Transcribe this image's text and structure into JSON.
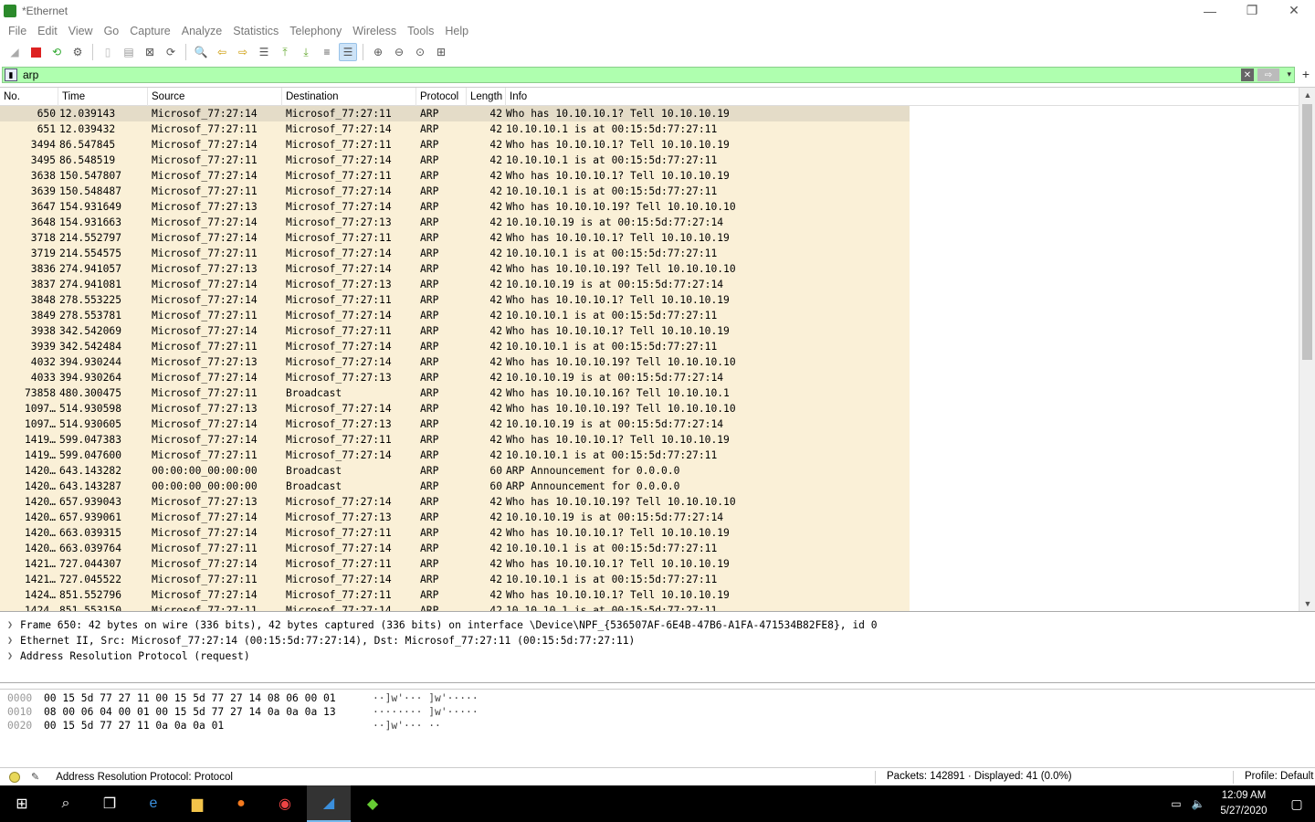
{
  "window": {
    "title": "*Ethernet",
    "controls": [
      "—",
      "❐",
      "✕"
    ]
  },
  "menu": [
    "File",
    "Edit",
    "View",
    "Go",
    "Capture",
    "Analyze",
    "Statistics",
    "Telephony",
    "Wireless",
    "Tools",
    "Help"
  ],
  "filter": {
    "value": "arp"
  },
  "columns": [
    "No.",
    "Time",
    "Source",
    "Destination",
    "Protocol",
    "Length",
    "Info"
  ],
  "packets": [
    [
      "650",
      "12.039143",
      "Microsof_77:27:14",
      "Microsof_77:27:11",
      "ARP",
      "42",
      "Who has 10.10.10.1? Tell 10.10.10.19"
    ],
    [
      "651",
      "12.039432",
      "Microsof_77:27:11",
      "Microsof_77:27:14",
      "ARP",
      "42",
      "10.10.10.1 is at 00:15:5d:77:27:11"
    ],
    [
      "3494",
      "86.547845",
      "Microsof_77:27:14",
      "Microsof_77:27:11",
      "ARP",
      "42",
      "Who has 10.10.10.1? Tell 10.10.10.19"
    ],
    [
      "3495",
      "86.548519",
      "Microsof_77:27:11",
      "Microsof_77:27:14",
      "ARP",
      "42",
      "10.10.10.1 is at 00:15:5d:77:27:11"
    ],
    [
      "3638",
      "150.547807",
      "Microsof_77:27:14",
      "Microsof_77:27:11",
      "ARP",
      "42",
      "Who has 10.10.10.1? Tell 10.10.10.19"
    ],
    [
      "3639",
      "150.548487",
      "Microsof_77:27:11",
      "Microsof_77:27:14",
      "ARP",
      "42",
      "10.10.10.1 is at 00:15:5d:77:27:11"
    ],
    [
      "3647",
      "154.931649",
      "Microsof_77:27:13",
      "Microsof_77:27:14",
      "ARP",
      "42",
      "Who has 10.10.10.19? Tell 10.10.10.10"
    ],
    [
      "3648",
      "154.931663",
      "Microsof_77:27:14",
      "Microsof_77:27:13",
      "ARP",
      "42",
      "10.10.10.19 is at 00:15:5d:77:27:14"
    ],
    [
      "3718",
      "214.552797",
      "Microsof_77:27:14",
      "Microsof_77:27:11",
      "ARP",
      "42",
      "Who has 10.10.10.1? Tell 10.10.10.19"
    ],
    [
      "3719",
      "214.554575",
      "Microsof_77:27:11",
      "Microsof_77:27:14",
      "ARP",
      "42",
      "10.10.10.1 is at 00:15:5d:77:27:11"
    ],
    [
      "3836",
      "274.941057",
      "Microsof_77:27:13",
      "Microsof_77:27:14",
      "ARP",
      "42",
      "Who has 10.10.10.19? Tell 10.10.10.10"
    ],
    [
      "3837",
      "274.941081",
      "Microsof_77:27:14",
      "Microsof_77:27:13",
      "ARP",
      "42",
      "10.10.10.19 is at 00:15:5d:77:27:14"
    ],
    [
      "3848",
      "278.553225",
      "Microsof_77:27:14",
      "Microsof_77:27:11",
      "ARP",
      "42",
      "Who has 10.10.10.1? Tell 10.10.10.19"
    ],
    [
      "3849",
      "278.553781",
      "Microsof_77:27:11",
      "Microsof_77:27:14",
      "ARP",
      "42",
      "10.10.10.1 is at 00:15:5d:77:27:11"
    ],
    [
      "3938",
      "342.542069",
      "Microsof_77:27:14",
      "Microsof_77:27:11",
      "ARP",
      "42",
      "Who has 10.10.10.1? Tell 10.10.10.19"
    ],
    [
      "3939",
      "342.542484",
      "Microsof_77:27:11",
      "Microsof_77:27:14",
      "ARP",
      "42",
      "10.10.10.1 is at 00:15:5d:77:27:11"
    ],
    [
      "4032",
      "394.930244",
      "Microsof_77:27:13",
      "Microsof_77:27:14",
      "ARP",
      "42",
      "Who has 10.10.10.19? Tell 10.10.10.10"
    ],
    [
      "4033",
      "394.930264",
      "Microsof_77:27:14",
      "Microsof_77:27:13",
      "ARP",
      "42",
      "10.10.10.19 is at 00:15:5d:77:27:14"
    ],
    [
      "73858",
      "480.300475",
      "Microsof_77:27:11",
      "Broadcast",
      "ARP",
      "42",
      "Who has 10.10.10.16? Tell 10.10.10.1"
    ],
    [
      "1097…",
      "514.930598",
      "Microsof_77:27:13",
      "Microsof_77:27:14",
      "ARP",
      "42",
      "Who has 10.10.10.19? Tell 10.10.10.10"
    ],
    [
      "1097…",
      "514.930605",
      "Microsof_77:27:14",
      "Microsof_77:27:13",
      "ARP",
      "42",
      "10.10.10.19 is at 00:15:5d:77:27:14"
    ],
    [
      "1419…",
      "599.047383",
      "Microsof_77:27:14",
      "Microsof_77:27:11",
      "ARP",
      "42",
      "Who has 10.10.10.1? Tell 10.10.10.19"
    ],
    [
      "1419…",
      "599.047600",
      "Microsof_77:27:11",
      "Microsof_77:27:14",
      "ARP",
      "42",
      "10.10.10.1 is at 00:15:5d:77:27:11"
    ],
    [
      "1420…",
      "643.143282",
      "00:00:00_00:00:00",
      "Broadcast",
      "ARP",
      "60",
      "ARP Announcement for 0.0.0.0"
    ],
    [
      "1420…",
      "643.143287",
      "00:00:00_00:00:00",
      "Broadcast",
      "ARP",
      "60",
      "ARP Announcement for 0.0.0.0"
    ],
    [
      "1420…",
      "657.939043",
      "Microsof_77:27:13",
      "Microsof_77:27:14",
      "ARP",
      "42",
      "Who has 10.10.10.19? Tell 10.10.10.10"
    ],
    [
      "1420…",
      "657.939061",
      "Microsof_77:27:14",
      "Microsof_77:27:13",
      "ARP",
      "42",
      "10.10.10.19 is at 00:15:5d:77:27:14"
    ],
    [
      "1420…",
      "663.039315",
      "Microsof_77:27:14",
      "Microsof_77:27:11",
      "ARP",
      "42",
      "Who has 10.10.10.1? Tell 10.10.10.19"
    ],
    [
      "1420…",
      "663.039764",
      "Microsof_77:27:11",
      "Microsof_77:27:14",
      "ARP",
      "42",
      "10.10.10.1 is at 00:15:5d:77:27:11"
    ],
    [
      "1421…",
      "727.044307",
      "Microsof_77:27:14",
      "Microsof_77:27:11",
      "ARP",
      "42",
      "Who has 10.10.10.1? Tell 10.10.10.19"
    ],
    [
      "1421…",
      "727.045522",
      "Microsof_77:27:11",
      "Microsof_77:27:14",
      "ARP",
      "42",
      "10.10.10.1 is at 00:15:5d:77:27:11"
    ],
    [
      "1424…",
      "851.552796",
      "Microsof_77:27:14",
      "Microsof_77:27:11",
      "ARP",
      "42",
      "Who has 10.10.10.1? Tell 10.10.10.19"
    ],
    [
      "1424…",
      "851.553150",
      "Microsof_77:27:11",
      "Microsof_77:27:14",
      "ARP",
      "42",
      "10.10.10.1 is at 00:15:5d:77:27:11"
    ]
  ],
  "details": [
    "Frame 650: 42 bytes on wire (336 bits), 42 bytes captured (336 bits) on interface \\Device\\NPF_{536507AF-6E4B-47B6-A1FA-471534B82FE8}, id 0",
    "Ethernet II, Src: Microsof_77:27:14 (00:15:5d:77:27:14), Dst: Microsof_77:27:11 (00:15:5d:77:27:11)",
    "Address Resolution Protocol (request)"
  ],
  "bytes": [
    {
      "offset": "0000",
      "hex": "00 15 5d 77 27 11 00 15  5d 77 27 14 08 06 00 01",
      "ascii": "··]w'··· ]w'·····"
    },
    {
      "offset": "0010",
      "hex": "08 00 06 04 00 01 00 15  5d 77 27 14 0a 0a 0a 13",
      "ascii": "········ ]w'·····"
    },
    {
      "offset": "0020",
      "hex": "00 15 5d 77 27 11 0a 0a  0a 01",
      "ascii": "··]w'··· ··"
    }
  ],
  "status": {
    "text": "Address Resolution Protocol: Protocol",
    "packets": "Packets: 142891 · Displayed: 41 (0.0%)",
    "profile": "Profile: Default"
  },
  "taskbar": {
    "time": "12:09 AM",
    "date": "5/27/2020"
  },
  "colors": {
    "filter_ok": "#afffaf",
    "arp_row": "#faf0d7",
    "selected_row": "#e4dcc8"
  }
}
